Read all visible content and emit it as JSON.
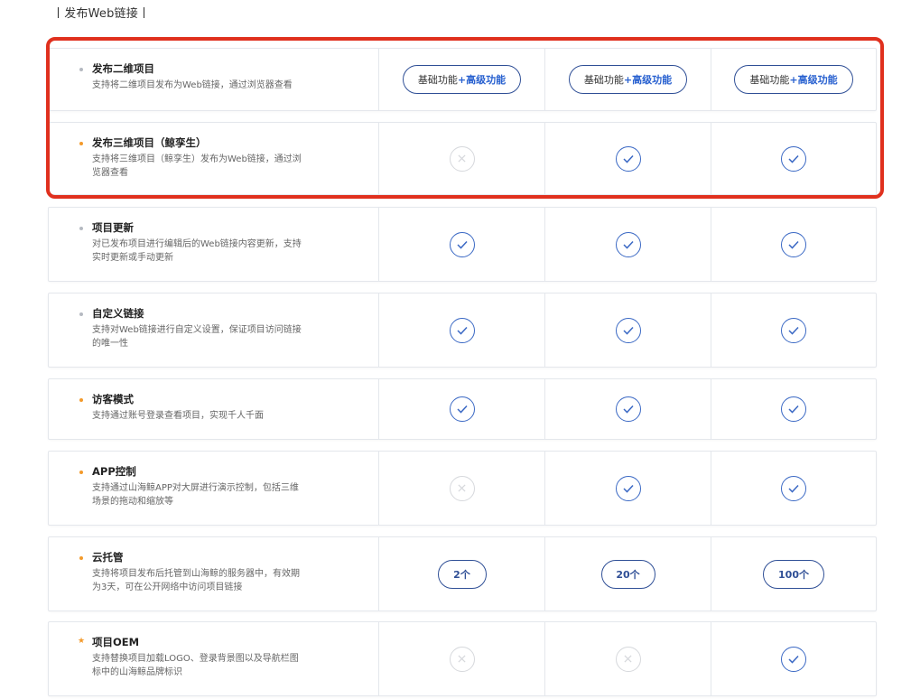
{
  "section": {
    "title": "丨发布Web链接丨"
  },
  "icons": {
    "check": "check-icon",
    "cross": "cross-icon",
    "dot": "bullet-dot",
    "star": "star-icon"
  },
  "colors": {
    "accent": "#3a68c4",
    "highlight": "#e0301e",
    "orange": "#f39a2b",
    "disabled": "#d6d8dc"
  },
  "rows": [
    {
      "name": "发布二维项目",
      "desc": "支持将二维项目发布为Web链接，通过浏览器查看",
      "marker": "dot",
      "cells": [
        {
          "type": "pill",
          "base": "基础功能",
          "plus": "+高级功能"
        },
        {
          "type": "pill",
          "base": "基础功能",
          "plus": "+高级功能"
        },
        {
          "type": "pill",
          "base": "基础功能",
          "plus": "+高级功能"
        }
      ]
    },
    {
      "name": "发布三维项目（鲸孪生）",
      "desc": "支持将三维项目（鲸孪生）发布为Web链接，通过浏览器查看",
      "marker": "orange",
      "cells": [
        {
          "type": "cross"
        },
        {
          "type": "check"
        },
        {
          "type": "check"
        }
      ]
    },
    {
      "name": "项目更新",
      "desc": "对已发布项目进行编辑后的Web链接内容更新，支持实时更新或手动更新",
      "marker": "dot",
      "cells": [
        {
          "type": "check"
        },
        {
          "type": "check"
        },
        {
          "type": "check"
        }
      ]
    },
    {
      "name": "自定义链接",
      "desc": "支持对Web链接进行自定义设置，保证项目访问链接的唯一性",
      "marker": "dot",
      "cells": [
        {
          "type": "check"
        },
        {
          "type": "check"
        },
        {
          "type": "check"
        }
      ]
    },
    {
      "name": "访客模式",
      "desc": "支持通过账号登录查看项目，实现千人千面",
      "marker": "orange",
      "cells": [
        {
          "type": "check"
        },
        {
          "type": "check"
        },
        {
          "type": "check"
        }
      ]
    },
    {
      "name": "APP控制",
      "desc": "支持通过山海鲸APP对大屏进行演示控制，包括三维场景的拖动和缩放等",
      "marker": "orange",
      "cells": [
        {
          "type": "cross"
        },
        {
          "type": "check"
        },
        {
          "type": "check"
        }
      ]
    },
    {
      "name": "云托管",
      "desc": "支持将项目发布后托管到山海鲸的服务器中，有效期为3天，可在公开网络中访问项目链接",
      "marker": "orange",
      "cells": [
        {
          "type": "count",
          "text": "2个"
        },
        {
          "type": "count",
          "text": "20个"
        },
        {
          "type": "count",
          "text": "100个"
        }
      ]
    },
    {
      "name": "项目OEM",
      "desc": "支持替换项目加载LOGO、登录背景图以及导航栏图标中的山海鲸品牌标识",
      "marker": "star",
      "cells": [
        {
          "type": "cross"
        },
        {
          "type": "cross"
        },
        {
          "type": "check"
        }
      ]
    }
  ]
}
